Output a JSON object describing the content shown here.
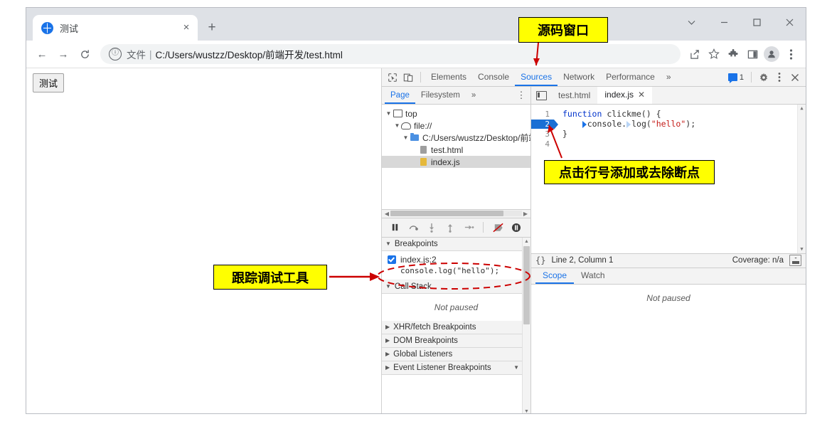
{
  "browser": {
    "tab": {
      "title": "测试",
      "favicon": "globe-icon",
      "close": "×"
    },
    "new_tab": "+",
    "window_controls": {
      "chevron": "⌄",
      "minimize": "—",
      "maximize": "□",
      "close": "✕"
    },
    "nav": {
      "back": "←",
      "forward": "→",
      "reload": "C"
    },
    "omnibox": {
      "info_icon": "ⓘ",
      "scheme_label": "文件",
      "separator": "|",
      "url": "C:/Users/wustzz/Desktop/前端开发/test.html"
    },
    "toolbar_icons": [
      "share-icon",
      "bookmark-star-icon",
      "extensions-puzzle-icon",
      "side-panel-icon",
      "profile-avatar",
      "chrome-menu-icon"
    ]
  },
  "page": {
    "button_label": "测试"
  },
  "devtools": {
    "top_tabs": [
      {
        "label": "Elements",
        "active": false
      },
      {
        "label": "Console",
        "active": false
      },
      {
        "label": "Sources",
        "active": true
      },
      {
        "label": "Network",
        "active": false
      },
      {
        "label": "Performance",
        "active": false
      },
      {
        "label": "»",
        "active": false
      }
    ],
    "left_icons": [
      "inspect-element-icon",
      "device-toolbar-icon"
    ],
    "messages": {
      "count": "1"
    },
    "right_icons": [
      "settings-gear-icon",
      "devtools-menu-icon",
      "devtools-close-icon"
    ],
    "navigator": {
      "subtabs": [
        {
          "label": "Page",
          "active": true
        },
        {
          "label": "Filesystem",
          "active": false
        },
        {
          "label": "»",
          "active": false
        }
      ],
      "more": "⋮",
      "tree": [
        {
          "label": "top",
          "depth": 0,
          "icon": "frame-icon",
          "arrow": "▼",
          "selected": false
        },
        {
          "label": "file://",
          "depth": 1,
          "icon": "cloud-icon",
          "arrow": "▼",
          "selected": false
        },
        {
          "label": "C:/Users/wustzz/Desktop/前端",
          "depth": 2,
          "icon": "folder-icon",
          "arrow": "▼",
          "selected": false
        },
        {
          "label": "test.html",
          "depth": 3,
          "icon": "document-icon",
          "arrow": "",
          "selected": false
        },
        {
          "label": "index.js",
          "depth": 3,
          "icon": "js-file-icon",
          "arrow": "",
          "selected": true
        }
      ]
    },
    "debug_toolbar": [
      {
        "name": "pause-resume-button",
        "glyph": "pause"
      },
      {
        "name": "step-over-button",
        "glyph": "step-over"
      },
      {
        "name": "step-into-button",
        "glyph": "step-into"
      },
      {
        "name": "step-out-button",
        "glyph": "step-out"
      },
      {
        "name": "step-button",
        "glyph": "step"
      },
      {
        "name": "deactivate-breakpoints-button",
        "glyph": "deactivate"
      },
      {
        "name": "pause-on-exceptions-button",
        "glyph": "exception"
      }
    ],
    "panes": [
      {
        "label": "Breakpoints",
        "expanded": true
      },
      {
        "label": "Call Stack",
        "expanded": true
      },
      {
        "label": "XHR/fetch Breakpoints",
        "expanded": false
      },
      {
        "label": "DOM Breakpoints",
        "expanded": false
      },
      {
        "label": "Global Listeners",
        "expanded": false
      },
      {
        "label": "Event Listener Breakpoints",
        "expanded": false
      }
    ],
    "breakpoint": {
      "checked": true,
      "location": "index.js:2",
      "code": "console.log(\"hello\");"
    },
    "call_stack_empty": "Not paused",
    "editor": {
      "tabs": [
        {
          "label": "test.html",
          "active": false,
          "closable": false
        },
        {
          "label": "index.js",
          "active": true,
          "closable": true,
          "close": "✕"
        }
      ],
      "lines": [
        {
          "num": "1",
          "breakpoint": false,
          "text": "function clickme() {"
        },
        {
          "num": "2",
          "breakpoint": true,
          "text": "console.log(\"hello\");"
        },
        {
          "num": "3",
          "breakpoint": false,
          "text": "}"
        },
        {
          "num": "4",
          "breakpoint": false,
          "text": ""
        }
      ],
      "status": {
        "format_icon": "{}",
        "position": "Line 2, Column 1",
        "coverage": "Coverage: n/a",
        "dock_icon": "dock-to-bottom-icon"
      }
    },
    "scope_watch": {
      "tabs": [
        {
          "label": "Scope",
          "active": true
        },
        {
          "label": "Watch",
          "active": false
        }
      ],
      "empty": "Not paused"
    }
  },
  "annotations": [
    {
      "id": "source-window",
      "text": "源码窗口"
    },
    {
      "id": "breakpoint-hint",
      "text": "点击行号添加或去除断点"
    },
    {
      "id": "debug-tools",
      "text": "跟踪调试工具"
    }
  ],
  "colors": {
    "accent": "#1a73e8",
    "annotation_bg": "#ffff00",
    "annotation_border": "#000000",
    "arrow_red": "#cc0000"
  }
}
